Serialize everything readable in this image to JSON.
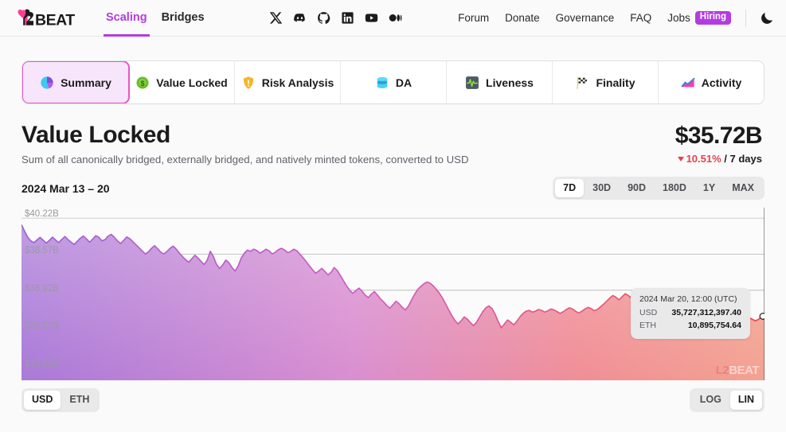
{
  "header": {
    "logo_text": "L2BEAT",
    "main_nav": [
      {
        "label": "Scaling",
        "active": true
      },
      {
        "label": "Bridges",
        "active": false
      }
    ],
    "socials": [
      {
        "name": "x-icon"
      },
      {
        "name": "discord-icon"
      },
      {
        "name": "github-icon"
      },
      {
        "name": "linkedin-icon"
      },
      {
        "name": "youtube-icon"
      },
      {
        "name": "medium-icon"
      }
    ],
    "util_nav": [
      {
        "label": "Forum"
      },
      {
        "label": "Donate"
      },
      {
        "label": "Governance"
      },
      {
        "label": "FAQ"
      }
    ],
    "jobs_label": "Jobs",
    "jobs_badge": "Hiring",
    "theme_toggle": "dark-mode-moon-icon"
  },
  "tabs": [
    {
      "label": "Summary",
      "icon": "pie-chart-icon",
      "active": true
    },
    {
      "label": "Value Locked",
      "icon": "dollar-coin-icon",
      "active": false
    },
    {
      "label": "Risk Analysis",
      "icon": "warning-shield-icon",
      "active": false
    },
    {
      "label": "DA",
      "icon": "database-icon",
      "active": false
    },
    {
      "label": "Liveness",
      "icon": "pulse-icon",
      "active": false
    },
    {
      "label": "Finality",
      "icon": "checkered-flag-icon",
      "active": false
    },
    {
      "label": "Activity",
      "icon": "area-chart-icon",
      "active": false
    }
  ],
  "main": {
    "title": "Value Locked",
    "subtitle": "Sum of all canonically bridged, externally bridged, and natively minted tokens, converted to USD",
    "total_value": "$35.72B",
    "change_pct": "10.51%",
    "change_direction": "down",
    "change_period": "/ 7 days",
    "date_range": "2024 Mar 13 – 20"
  },
  "range_selector": {
    "options": [
      "7D",
      "30D",
      "90D",
      "180D",
      "1Y",
      "MAX"
    ],
    "selected": "7D"
  },
  "unit_selector": {
    "options": [
      "USD",
      "ETH"
    ],
    "selected": "USD"
  },
  "scale_selector": {
    "options": [
      "LOG",
      "LIN"
    ],
    "selected": "LIN"
  },
  "tooltip": {
    "date": "2024 Mar 20, 12:00 (UTC)",
    "rows": [
      {
        "key": "USD",
        "value": "35,727,312,397.40"
      },
      {
        "key": "ETH",
        "value": "10,895,754.64"
      }
    ]
  },
  "watermark": {
    "prefix": "L2",
    "suffix": "BEAT"
  },
  "colors": {
    "accent_purple": "#b33ce0",
    "accent_pink": "#e857c4",
    "negative_red": "#e8424b",
    "line_start": "#9b5fd0",
    "line_end": "#e8424b",
    "page_bg": "#fafafa"
  },
  "chart_data": {
    "type": "area",
    "title": "Value Locked",
    "xlabel": "",
    "ylabel": "USD",
    "grid": true,
    "legend": "none",
    "ytick_labels": [
      "$40.22B",
      "$38.57B",
      "$36.92B",
      "$35.27B",
      "$33.62B"
    ],
    "ytick_values": [
      40.22,
      38.57,
      36.92,
      35.27,
      33.62
    ],
    "ylim": [
      32.8,
      40.7
    ],
    "x_start": "2024-03-13",
    "x_end": "2024-03-20 12:00 UTC",
    "unit": "billions USD",
    "values": [
      39.92,
      39.62,
      39.35,
      39.18,
      39.1,
      39.22,
      39.34,
      39.21,
      39.08,
      39.2,
      39.35,
      39.22,
      39.1,
      39.24,
      39.38,
      39.24,
      39.12,
      39.02,
      39.16,
      39.3,
      39.4,
      39.27,
      39.12,
      39.26,
      39.42,
      39.34,
      39.18,
      39.24,
      39.4,
      39.48,
      39.34,
      39.18,
      39.06,
      39.2,
      39.36,
      39.28,
      39.14,
      39.0,
      38.86,
      38.72,
      38.58,
      38.68,
      38.84,
      38.96,
      38.82,
      38.66,
      38.58,
      38.7,
      38.84,
      38.94,
      38.8,
      38.62,
      38.46,
      38.32,
      38.2,
      38.36,
      38.52,
      38.4,
      38.24,
      38.1,
      38.3,
      38.7,
      38.46,
      38.1,
      37.92,
      38.08,
      38.3,
      38.18,
      37.96,
      37.8,
      38.04,
      38.4,
      38.62,
      38.76,
      38.7,
      38.8,
      38.74,
      38.62,
      38.7,
      38.8,
      38.72,
      38.58,
      38.66,
      38.78,
      38.84,
      38.76,
      38.64,
      38.7,
      38.8,
      38.72,
      38.56,
      38.4,
      38.22,
      38.04,
      37.86,
      37.7,
      37.8,
      37.92,
      37.78,
      37.62,
      37.74,
      37.96,
      37.82,
      37.6,
      37.36,
      37.12,
      36.92,
      36.78,
      36.9,
      37.02,
      36.88,
      36.7,
      36.58,
      36.74,
      36.86,
      36.7,
      36.52,
      36.38,
      36.22,
      36.1,
      36.26,
      36.42,
      36.3,
      36.14,
      36.02,
      36.2,
      36.48,
      36.74,
      36.96,
      37.1,
      37.22,
      37.3,
      37.24,
      37.12,
      36.96,
      36.78,
      36.56,
      36.3,
      36.02,
      35.76,
      35.54,
      35.38,
      35.52,
      35.7,
      35.6,
      35.44,
      35.3,
      35.46,
      35.7,
      35.94,
      36.12,
      36.2,
      36.08,
      35.82,
      35.48,
      35.2,
      35.38,
      35.56,
      35.46,
      35.34,
      35.5,
      35.7,
      35.86,
      35.96,
      36.0,
      35.92,
      35.96,
      36.04,
      36.0,
      35.92,
      35.98,
      36.06,
      36.02,
      35.94,
      35.86,
      35.94,
      36.04,
      36.12,
      36.06,
      35.96,
      35.88,
      35.96,
      36.06,
      36.14,
      36.08,
      35.98,
      36.04,
      36.16,
      36.28,
      36.42,
      36.56,
      36.68,
      36.6,
      36.48,
      36.62,
      36.76,
      36.68,
      36.56,
      36.44,
      36.3,
      36.16,
      36.02,
      35.88,
      35.74,
      35.6,
      35.44,
      35.3,
      35.16,
      35.0,
      34.72,
      35.1,
      35.3,
      35.16,
      34.8,
      35.2,
      35.42,
      35.38,
      35.3,
      35.36,
      35.44,
      35.4,
      35.34,
      35.42,
      35.52,
      35.48,
      35.4,
      35.46,
      35.56,
      35.52,
      35.44,
      35.5,
      35.62,
      35.58,
      35.5,
      35.56,
      35.66,
      35.6,
      35.52,
      35.58,
      35.72,
      35.73
    ],
    "hover_point": {
      "label": "2024 Mar 20, 12:00 (UTC)",
      "usd": "35,727,312,397.40",
      "eth": "10,895,754.64",
      "value": 35.73
    }
  }
}
